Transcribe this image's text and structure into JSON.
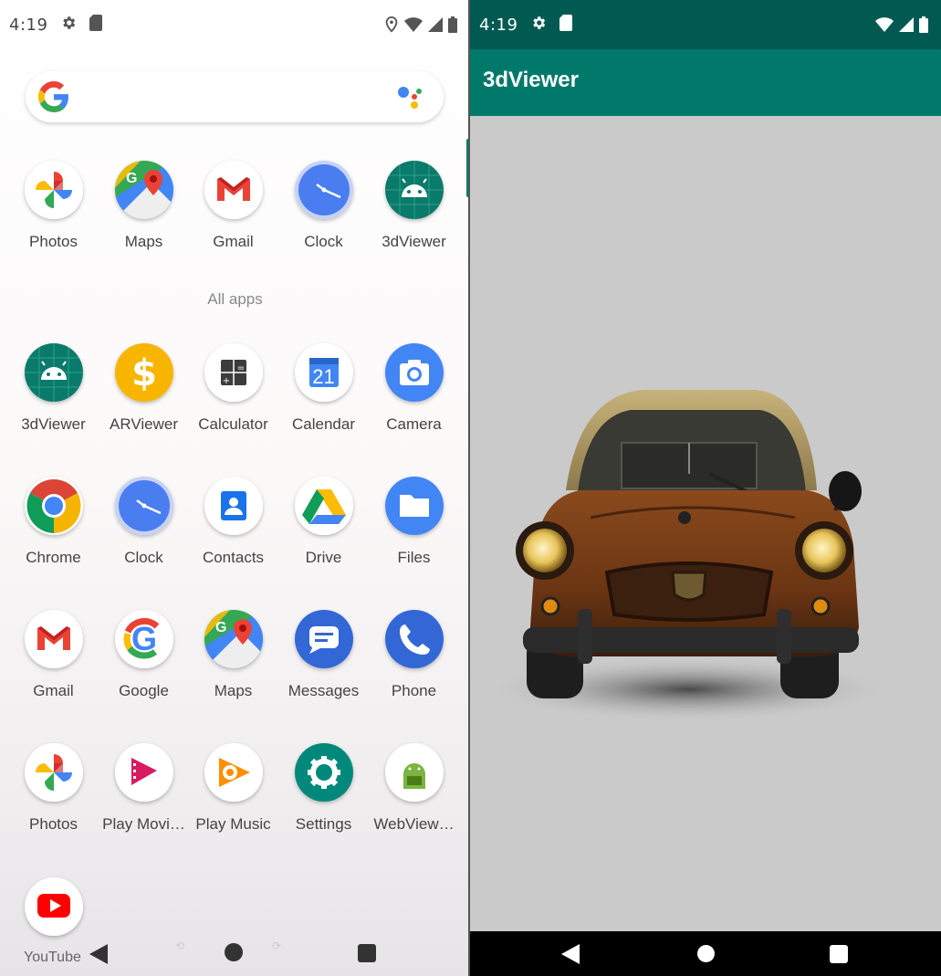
{
  "launcher": {
    "status_bar": {
      "time": "4:19"
    },
    "hotseat": [
      {
        "label": "Photos",
        "icon": "photos-icon"
      },
      {
        "label": "Maps",
        "icon": "maps-icon"
      },
      {
        "label": "Gmail",
        "icon": "gmail-icon"
      },
      {
        "label": "Clock",
        "icon": "clock-icon"
      },
      {
        "label": "3dViewer",
        "icon": "android-icon"
      }
    ],
    "all_apps_label": "All apps",
    "apps": [
      {
        "label": "3dViewer",
        "icon": "android-icon"
      },
      {
        "label": "ARViewer",
        "icon": "dollar-icon"
      },
      {
        "label": "Calculator",
        "icon": "calculator-icon"
      },
      {
        "label": "Calendar",
        "icon": "calendar-icon",
        "text": "21"
      },
      {
        "label": "Camera",
        "icon": "camera-icon"
      },
      {
        "label": "Chrome",
        "icon": "chrome-icon"
      },
      {
        "label": "Clock",
        "icon": "clock-icon"
      },
      {
        "label": "Contacts",
        "icon": "contacts-icon"
      },
      {
        "label": "Drive",
        "icon": "drive-icon"
      },
      {
        "label": "Files",
        "icon": "files-icon"
      },
      {
        "label": "Gmail",
        "icon": "gmail-icon"
      },
      {
        "label": "Google",
        "icon": "google-icon"
      },
      {
        "label": "Maps",
        "icon": "maps-icon"
      },
      {
        "label": "Messages",
        "icon": "messages-icon"
      },
      {
        "label": "Phone",
        "icon": "phone-icon"
      },
      {
        "label": "Photos",
        "icon": "photos-icon"
      },
      {
        "label": "Play Movi…",
        "icon": "play-movies-icon"
      },
      {
        "label": "Play Music",
        "icon": "play-music-icon"
      },
      {
        "label": "Settings",
        "icon": "settings-icon"
      },
      {
        "label": "WebView…",
        "icon": "webview-icon"
      },
      {
        "label": "YouTube",
        "icon": "youtube-icon"
      }
    ]
  },
  "viewer": {
    "status_bar": {
      "time": "4:19"
    },
    "toolbar_title": "3dViewer",
    "accent": "#00796b",
    "status_color": "#005a51"
  }
}
